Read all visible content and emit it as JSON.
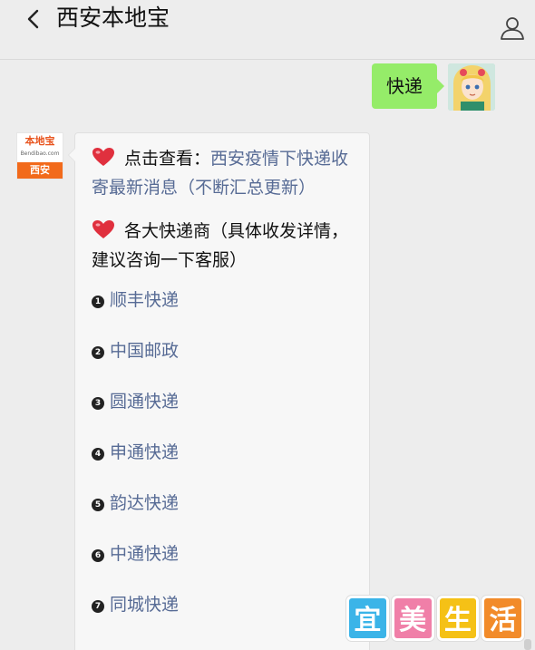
{
  "header": {
    "back_icon": "chevron-left-icon",
    "title": "西安本地宝",
    "profile_icon": "person-icon"
  },
  "outgoing": {
    "text": "快递",
    "bubble_color": "#95ec69"
  },
  "bot": {
    "logo_top": "本地宝",
    "logo_url": "Bendibao.com",
    "logo_city": "西安"
  },
  "message": {
    "para1_prefix": "点击查看：",
    "para1_link": "西安疫情下快递收寄最新消息（不断汇总更新）",
    "para2": "各大快递商（具体收发详情，建议咨询一下客服）",
    "heart_icon": "heart-icon",
    "link_color": "#576b95",
    "couriers": [
      {
        "num": "1",
        "name": "顺丰快递"
      },
      {
        "num": "2",
        "name": "中国邮政"
      },
      {
        "num": "3",
        "name": "圆通快递"
      },
      {
        "num": "4",
        "name": "申通快递"
      },
      {
        "num": "5",
        "name": "韵达快递"
      },
      {
        "num": "6",
        "name": "中通快递"
      },
      {
        "num": "7",
        "name": "同城快递"
      }
    ]
  },
  "watermark": {
    "chars": [
      "宜",
      "美",
      "生",
      "活"
    ],
    "colors": [
      "#3bb4e8",
      "#f07fa8",
      "#f5c116",
      "#f28b2a"
    ]
  }
}
